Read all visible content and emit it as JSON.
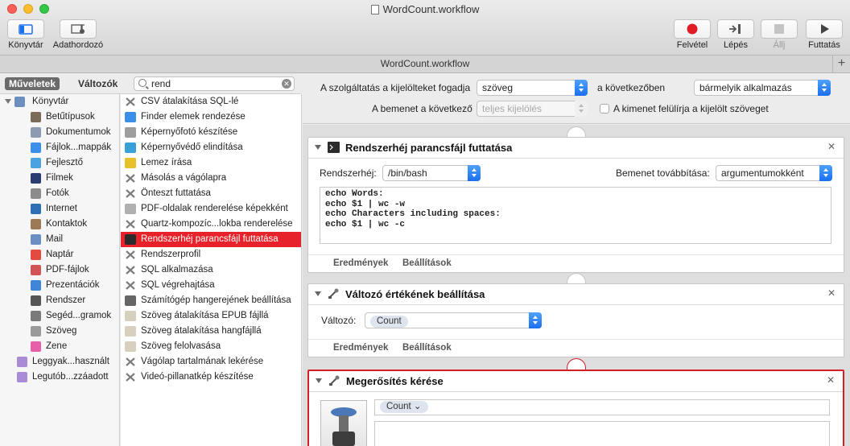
{
  "window": {
    "title": "WordCount.workflow",
    "tab_title": "WordCount.workflow"
  },
  "toolbar": {
    "library_label": "Könyvtár",
    "media_label": "Adathordozó",
    "record_label": "Felvétel",
    "step_label": "Lépés",
    "stop_label": "Állj",
    "run_label": "Futtatás"
  },
  "library": {
    "tab_actions": "Műveletek",
    "tab_variables": "Változók",
    "search_value": "rend",
    "root": "Könyvtár",
    "categories": [
      {
        "label": "Betűtípusok",
        "icon": "font-book-icon",
        "color": "#7b6a58"
      },
      {
        "label": "Dokumentumok",
        "icon": "document-icon",
        "color": "#8d9bb0"
      },
      {
        "label": "Fájlok...mappák",
        "icon": "finder-icon",
        "color": "#3b8fe8"
      },
      {
        "label": "Fejlesztő",
        "icon": "developer-icon",
        "color": "#4aa3e0"
      },
      {
        "label": "Filmek",
        "icon": "quicktime-icon",
        "color": "#2a3c70"
      },
      {
        "label": "Fotók",
        "icon": "photos-icon",
        "color": "#8c8c8c"
      },
      {
        "label": "Internet",
        "icon": "globe-icon",
        "color": "#2f6fb3"
      },
      {
        "label": "Kontaktok",
        "icon": "contacts-icon",
        "color": "#9b7a55"
      },
      {
        "label": "Mail",
        "icon": "mail-icon",
        "color": "#6a8fc4"
      },
      {
        "label": "Naptár",
        "icon": "calendar-icon",
        "color": "#e44b3f"
      },
      {
        "label": "PDF-fájlok",
        "icon": "pdf-icon",
        "color": "#d35454"
      },
      {
        "label": "Prezentációk",
        "icon": "presentation-icon",
        "color": "#3f86d9"
      },
      {
        "label": "Rendszer",
        "icon": "system-icon",
        "color": "#555555"
      },
      {
        "label": "Segéd...gramok",
        "icon": "utilities-icon",
        "color": "#7a7a7a"
      },
      {
        "label": "Szöveg",
        "icon": "text-icon",
        "color": "#9a9a9a"
      },
      {
        "label": "Zene",
        "icon": "music-icon",
        "color": "#e65fa8"
      }
    ],
    "smart_folders": [
      {
        "label": "Leggyak...használt",
        "icon": "smart-folder-icon",
        "color": "#a98bd6"
      },
      {
        "label": "Legutób...zzáadott",
        "icon": "smart-folder-icon",
        "color": "#a98bd6"
      }
    ],
    "actions": [
      {
        "label": "CSV átalakítása SQL-lé",
        "icon": "tools-icon"
      },
      {
        "label": "Finder elemek rendezése",
        "icon": "finder-icon"
      },
      {
        "label": "Képernyőfotó készítése",
        "icon": "screenshot-icon"
      },
      {
        "label": "Képernyővédő elindítása",
        "icon": "screensaver-icon"
      },
      {
        "label": "Lemez írása",
        "icon": "burn-icon"
      },
      {
        "label": "Másolás a vágólapra",
        "icon": "tools-icon"
      },
      {
        "label": "Önteszt futtatása",
        "icon": "tools-icon"
      },
      {
        "label": "PDF-oldalak renderelése képekként",
        "icon": "preview-icon"
      },
      {
        "label": "Quartz-kompozíc...lokba renderelése",
        "icon": "tools-icon"
      },
      {
        "label": "Rendszerhéj parancsfájl futtatása",
        "icon": "terminal-icon"
      },
      {
        "label": "Rendszerprofil",
        "icon": "tools-icon"
      },
      {
        "label": "SQL alkalmazása",
        "icon": "tools-icon"
      },
      {
        "label": "SQL végrehajtása",
        "icon": "tools-icon"
      },
      {
        "label": "Számítógép hangerejének beállítása",
        "icon": "volume-icon"
      },
      {
        "label": "Szöveg átalakítása EPUB fájllá",
        "icon": "textedit-icon"
      },
      {
        "label": "Szöveg átalakítása hangfájllá",
        "icon": "textedit-icon"
      },
      {
        "label": "Szöveg felolvasása",
        "icon": "textedit-icon"
      },
      {
        "label": "Vágólap tartalmának lekérése",
        "icon": "tools-icon"
      },
      {
        "label": "Videó-pillanatkép készítése",
        "icon": "tools-icon"
      }
    ],
    "selected_action_index": 9
  },
  "workflow_header": {
    "receives_label": "A szolgáltatás a kijelölteket fogadja",
    "receives_value": "szöveg",
    "in_label": "a következőben",
    "in_value": "bármelyik alkalmazás",
    "input_label": "A bemenet a következő",
    "input_value": "teljes kijelölés",
    "replace_label": "A kimenet felülírja a kijelölt szöveget"
  },
  "cards": {
    "shell": {
      "title": "Rendszerhéj parancsfájl futtatása",
      "shell_label": "Rendszerhéj:",
      "shell_value": "/bin/bash",
      "pass_label": "Bemenet továbbítása:",
      "pass_value": "argumentumokként",
      "code_lines": [
        "echo Words:",
        "echo $1 | wc -w",
        "echo Characters including spaces:",
        "echo $1 | wc -c"
      ],
      "results": "Eredmények",
      "options": "Beállítások"
    },
    "setvar": {
      "title": "Változó értékének beállítása",
      "var_label": "Változó:",
      "var_value": "Count",
      "results": "Eredmények",
      "options": "Beállítások"
    },
    "confirm": {
      "title": "Megerősítés kérése",
      "token": "Count"
    }
  },
  "colors": {
    "selection": "#e8222a",
    "accent": "#1a6fef",
    "record": "#e01b24"
  }
}
